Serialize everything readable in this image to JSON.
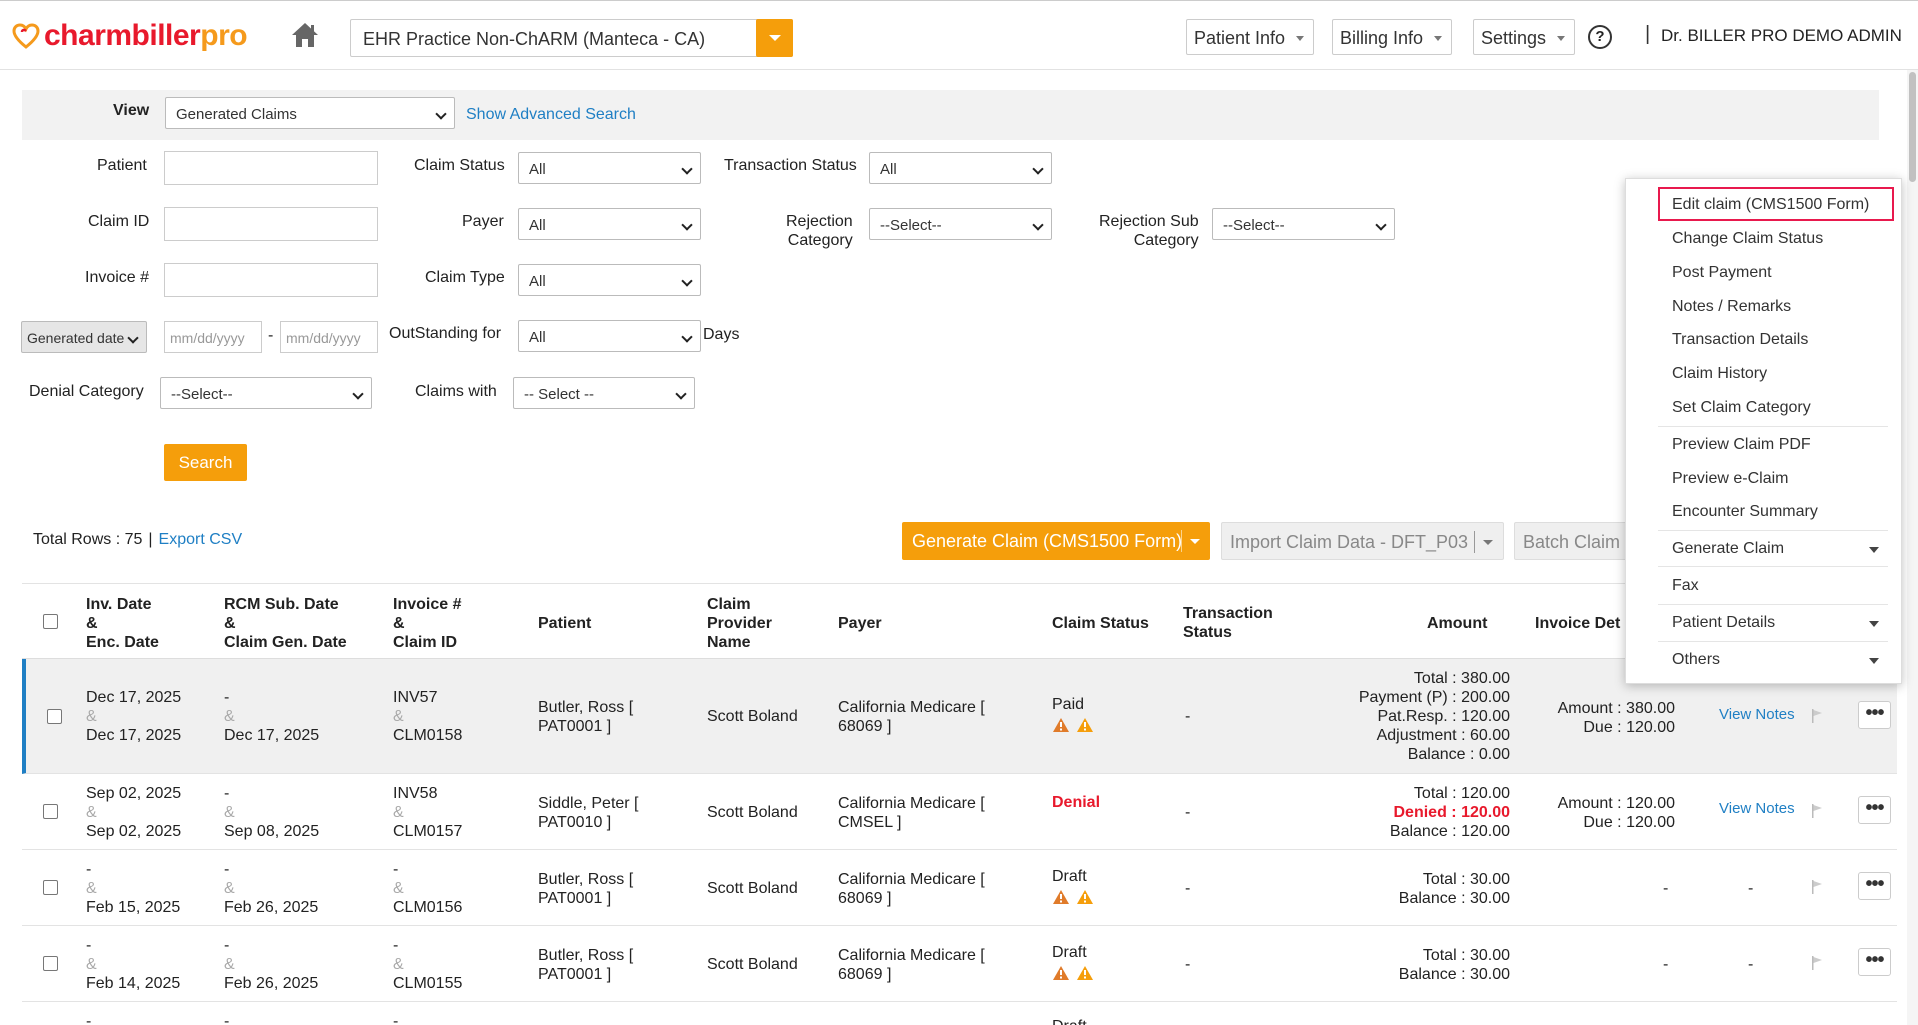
{
  "header": {
    "logo": {
      "charm": "charm",
      "biller": "biller",
      "pro": "pro"
    },
    "practice": "EHR Practice Non-ChARM (Manteca - CA)",
    "nav": [
      "Patient Info",
      "Billing Info",
      "Settings"
    ],
    "help": "?",
    "separator": "|",
    "user": "Dr. BILLER PRO DEMO ADMIN"
  },
  "filters": {
    "view_label": "View",
    "view_value": "Generated Claims",
    "advanced_search": "Show Advanced Search",
    "patient_label": "Patient",
    "claim_id_label": "Claim ID",
    "invoice_label": "Invoice #",
    "claim_status_label": "Claim Status",
    "claim_status_value": "All",
    "payer_label": "Payer",
    "payer_value": "All",
    "claim_type_label": "Claim Type",
    "claim_type_value": "All",
    "outstanding_label": "OutStanding for",
    "outstanding_value": "All",
    "days_label": "Days",
    "transaction_status_label": "Transaction Status",
    "transaction_status_value": "All",
    "rejection_category_label_1": "Rejection",
    "rejection_category_label_2": "Category",
    "rejection_category_value": "--Select--",
    "rejection_sub_label_1": "Rejection Sub",
    "rejection_sub_label_2": "Category",
    "rejection_sub_value": "--Select--",
    "date_type_value": "Generated date",
    "date_from_placeholder": "mm/dd/yyyy",
    "date_dash": "-",
    "date_to_placeholder": "mm/dd/yyyy",
    "denial_category_label": "Denial Category",
    "denial_category_value": "--Select--",
    "claims_with_label": "Claims with",
    "claims_with_value": "-- Select --",
    "search_button": "Search"
  },
  "toolbar": {
    "total_rows_label": "Total Rows : 75",
    "separator": "|",
    "export_csv": "Export CSV",
    "generate_claim": "Generate Claim (CMS1500 Form)",
    "import_claim": "Import Claim Data - DFT_P03",
    "batch_claim": "Batch Claim"
  },
  "table": {
    "headers": {
      "inv_date": [
        "Inv. Date",
        "&",
        "Enc. Date"
      ],
      "rcm_date": [
        "RCM Sub. Date",
        "&",
        "Claim Gen. Date"
      ],
      "invoice": [
        "Invoice #",
        "&",
        "Claim ID"
      ],
      "patient": "Patient",
      "provider": [
        "Claim",
        "Provider",
        "Name"
      ],
      "payer": "Payer",
      "claim_status": "Claim Status",
      "transaction_status": [
        "Transaction",
        "Status"
      ],
      "amount": "Amount",
      "invoice_details": "Invoice Det"
    },
    "rows": [
      {
        "inv_date": "Dec 17, 2025",
        "enc_date": "Dec 17, 2025",
        "rcm_date": "-",
        "gen_date": "Dec 17, 2025",
        "invoice": "INV57",
        "claim_id": "CLM0158",
        "patient_1": "Butler, Ross [",
        "patient_2": "PAT0001 ]",
        "provider": "Scott Boland",
        "payer_1": "California Medicare [",
        "payer_2": "68069 ]",
        "status": "Paid",
        "transaction": "-",
        "amount_lines": [
          "Total : 380.00",
          "Payment (P) : 200.00",
          "Pat.Resp. : 120.00",
          "Adjustment : 60.00",
          "Balance : 0.00"
        ],
        "inv_amount": "Amount : 380.00",
        "inv_due": "Due : 120.00",
        "notes": "View Notes",
        "more": "•••",
        "amp": "&"
      },
      {
        "inv_date": "Sep 02, 2025",
        "enc_date": "Sep 02, 2025",
        "rcm_date": "-",
        "gen_date": "Sep 08, 2025",
        "invoice": "INV58",
        "claim_id": "CLM0157",
        "patient_1": "Siddle, Peter [",
        "patient_2": "PAT0010 ]",
        "provider": "Scott Boland",
        "payer_1": "California Medicare [",
        "payer_2": "CMSEL ]",
        "status": "Denial",
        "transaction": "-",
        "amount_total": "Total : 120.00",
        "amount_denied": "Denied : 120.00",
        "amount_balance": "Balance : 120.00",
        "inv_amount": "Amount : 120.00",
        "inv_due": "Due : 120.00",
        "notes": "View Notes",
        "more": "•••",
        "amp": "&"
      },
      {
        "inv_date": "-",
        "enc_date": "Feb 15, 2025",
        "rcm_date": "-",
        "gen_date": "Feb 26, 2025",
        "invoice": "-",
        "claim_id": "CLM0156",
        "patient_1": "Butler, Ross [",
        "patient_2": "PAT0001 ]",
        "provider": "Scott Boland",
        "payer_1": "California Medicare [",
        "payer_2": "68069 ]",
        "status": "Draft",
        "transaction": "-",
        "amount_total": "Total : 30.00",
        "amount_balance": "Balance : 30.00",
        "inv_dash": "-",
        "notes_dash": "-",
        "more": "•••",
        "amp": "&"
      },
      {
        "inv_date": "-",
        "enc_date": "Feb 14, 2025",
        "rcm_date": "-",
        "gen_date": "Feb 26, 2025",
        "invoice": "-",
        "claim_id": "CLM0155",
        "patient_1": "Butler, Ross [",
        "patient_2": "PAT0001 ]",
        "provider": "Scott Boland",
        "payer_1": "California Medicare [",
        "payer_2": "68069 ]",
        "status": "Draft",
        "transaction": "-",
        "amount_total": "Total : 30.00",
        "amount_balance": "Balance : 30.00",
        "inv_dash": "-",
        "notes_dash": "-",
        "more": "•••",
        "amp": "&"
      },
      {
        "inv_date": "-",
        "rcm_date": "-",
        "invoice": "-",
        "status": "Draft"
      }
    ]
  },
  "context_menu": {
    "items": [
      "Edit claim (CMS1500 Form)",
      "Change Claim Status",
      "Post Payment",
      "Notes / Remarks",
      "Transaction Details",
      "Claim History",
      "Set Claim Category",
      "Preview Claim PDF",
      "Preview e-Claim",
      "Encounter Summary",
      "Generate Claim",
      "Fax",
      "Patient Details",
      "Others"
    ],
    "highlight_color": "#e8194d"
  },
  "colors": {
    "accent": "#f59e0b",
    "link": "#1f7fc4",
    "denial": "#e8192c",
    "brand_red": "#e8192c"
  }
}
